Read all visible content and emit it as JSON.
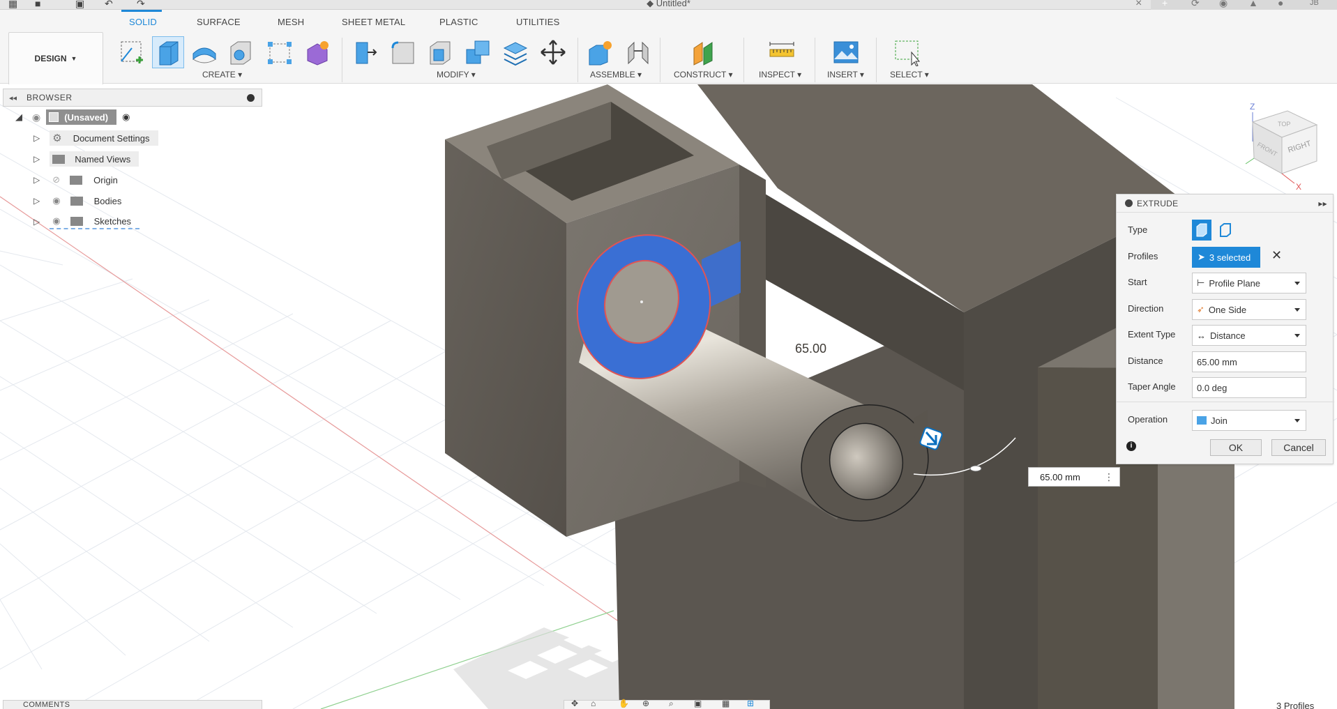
{
  "app": {
    "document_title": "Untitled*",
    "user_initials": "JB"
  },
  "toolbar": {
    "workspace_label": "DESIGN",
    "tabs": [
      {
        "label": "SOLID",
        "active": true
      },
      {
        "label": "SURFACE",
        "active": false
      },
      {
        "label": "MESH",
        "active": false
      },
      {
        "label": "SHEET METAL",
        "active": false
      },
      {
        "label": "PLASTIC",
        "active": false
      },
      {
        "label": "UTILITIES",
        "active": false
      }
    ],
    "groups": [
      {
        "label": "CREATE ▾"
      },
      {
        "label": "MODIFY ▾"
      },
      {
        "label": "ASSEMBLE ▾"
      },
      {
        "label": "CONSTRUCT ▾"
      },
      {
        "label": "INSPECT ▾"
      },
      {
        "label": "INSERT ▾"
      },
      {
        "label": "SELECT ▾"
      }
    ]
  },
  "browser": {
    "title": "BROWSER",
    "root": "(Unsaved)",
    "items": [
      {
        "label": "Document Settings"
      },
      {
        "label": "Named Views"
      },
      {
        "label": "Origin"
      },
      {
        "label": "Bodies"
      },
      {
        "label": "Sketches"
      }
    ]
  },
  "viewport": {
    "dimension_label": "65.00",
    "viewcube_right": "RIGHT",
    "viewcube_front": "FRONT",
    "viewcube_top": "TOP",
    "axis_z": "Z",
    "axis_x": "X",
    "dimension_input": "65.00 mm"
  },
  "extrude": {
    "title": "EXTRUDE",
    "rows": {
      "type_label": "Type",
      "profiles_label": "Profiles",
      "profiles_value": "3 selected",
      "start_label": "Start",
      "start_value": "Profile Plane",
      "direction_label": "Direction",
      "direction_value": "One Side",
      "extent_label": "Extent Type",
      "extent_value": "Distance",
      "distance_label": "Distance",
      "distance_value": "65.00 mm",
      "taper_label": "Taper Angle",
      "taper_value": "0.0 deg",
      "operation_label": "Operation",
      "operation_value": "Join"
    },
    "ok_label": "OK",
    "cancel_label": "Cancel"
  },
  "bottom": {
    "comments_label": "COMMENTS",
    "profiles_count": "3 Profiles"
  },
  "colors": {
    "accent": "#1e88d8",
    "selection_blue": "#3a6fd4",
    "body_dark": "#5f5a52",
    "body_mid": "#75706a",
    "axis_red": "#e05454",
    "axis_green": "#5fbf5f"
  }
}
